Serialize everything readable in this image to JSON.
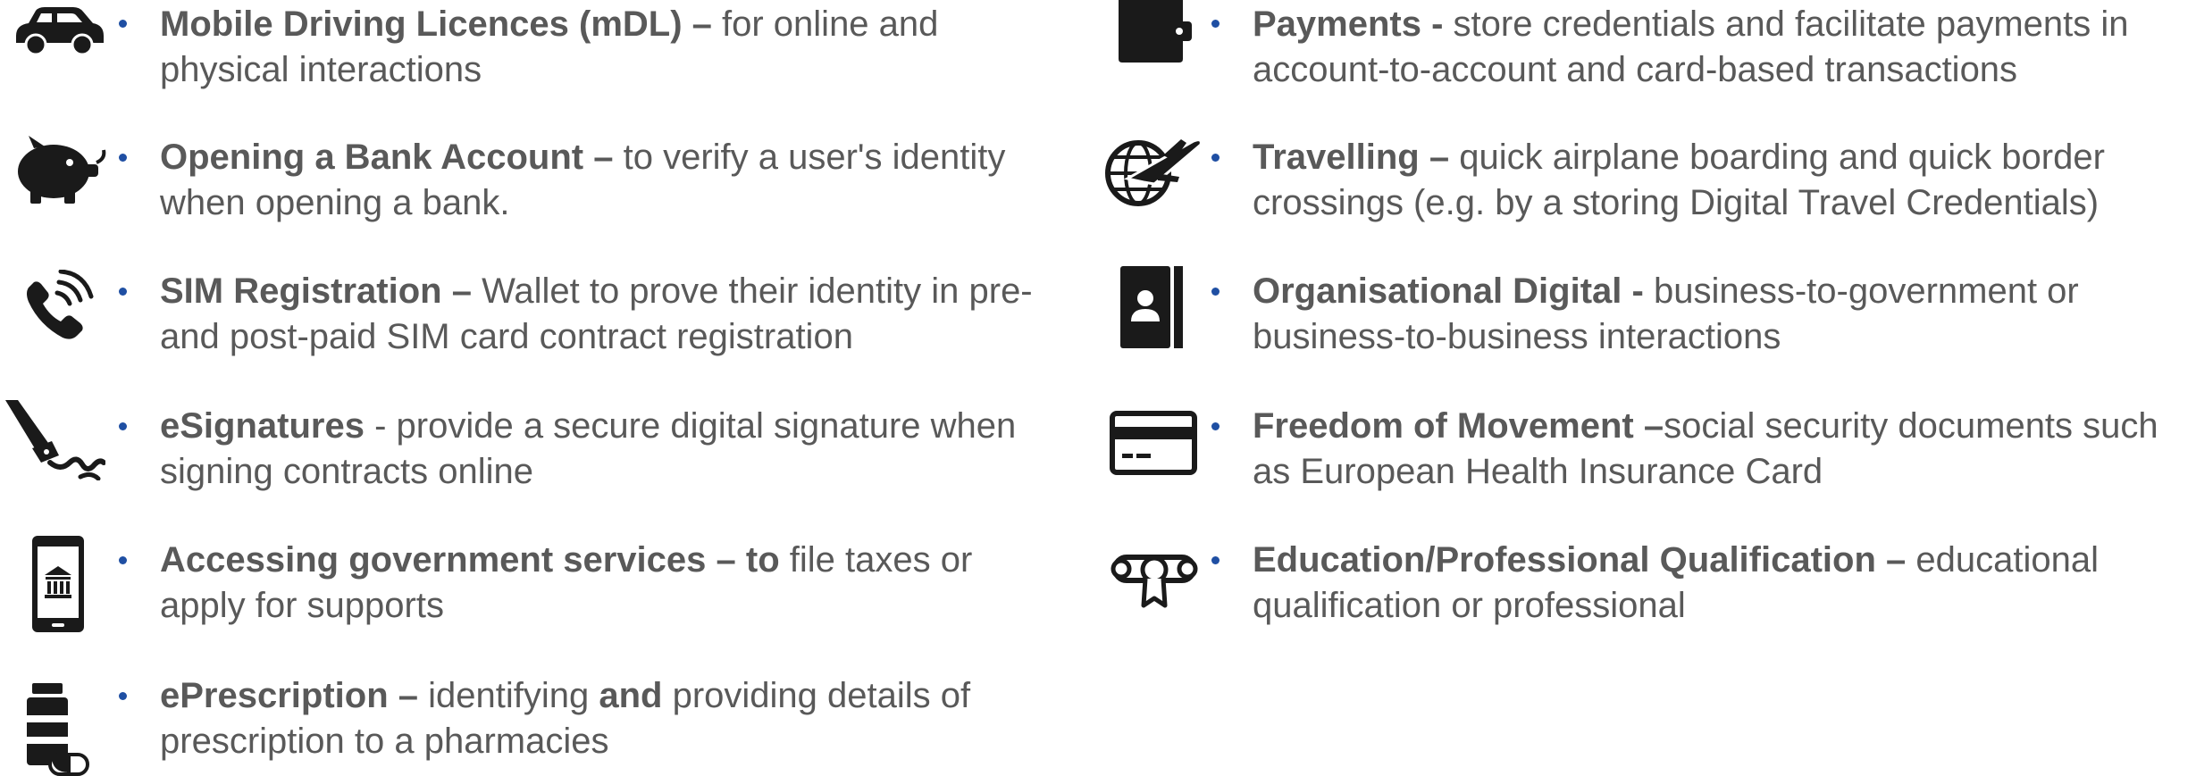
{
  "left_items": [
    {
      "icon": "car-icon",
      "bold": "Mobile Driving Licences (mDL) –",
      "rest": "  for  online and physical interactions"
    },
    {
      "icon": "piggy-bank-icon",
      "bold": "Opening a Bank Account –",
      "rest": " to verify a user's identity when opening a bank."
    },
    {
      "icon": "phone-ringing-icon",
      "bold": "SIM Registration –",
      "rest": " Wallet to prove their identity in pre- and post-paid SIM card contract registration"
    },
    {
      "icon": "signature-pen-icon",
      "bold": "eSignatures",
      "rest": " - provide a secure digital signature when signing contracts online"
    },
    {
      "icon": "mobile-government-icon",
      "bold": "Accessing government services – to",
      "rest": " file taxes or apply for supports"
    },
    {
      "icon": "medicine-bottle-icon",
      "bold": "ePrescription –",
      "rest": " identifying ",
      "bold2": "and",
      "rest2": " providing details of prescription to a pharmacies"
    }
  ],
  "right_items": [
    {
      "icon": "wallet-icon",
      "bold": "Payments -",
      "rest": " store credentials and facilitate payments in account-to-account and card-based transactions"
    },
    {
      "icon": "globe-airplane-icon",
      "bold": "Travelling –",
      "rest": "  quick airplane boarding and quick border crossings (e.g. by a storing Digital Travel Credentials)"
    },
    {
      "icon": "contact-book-icon",
      "bold": "Organisational Digital -",
      "rest": " business-to-government or business-to-business interactions"
    },
    {
      "icon": "credit-card-icon",
      "bold": "Freedom of Movement –",
      "rest": "social security documents such as European Health Insurance Card"
    },
    {
      "icon": "diploma-certificate-icon",
      "bold": "Education/Professional Qualification –",
      "rest": " educational qualification or professional"
    }
  ]
}
